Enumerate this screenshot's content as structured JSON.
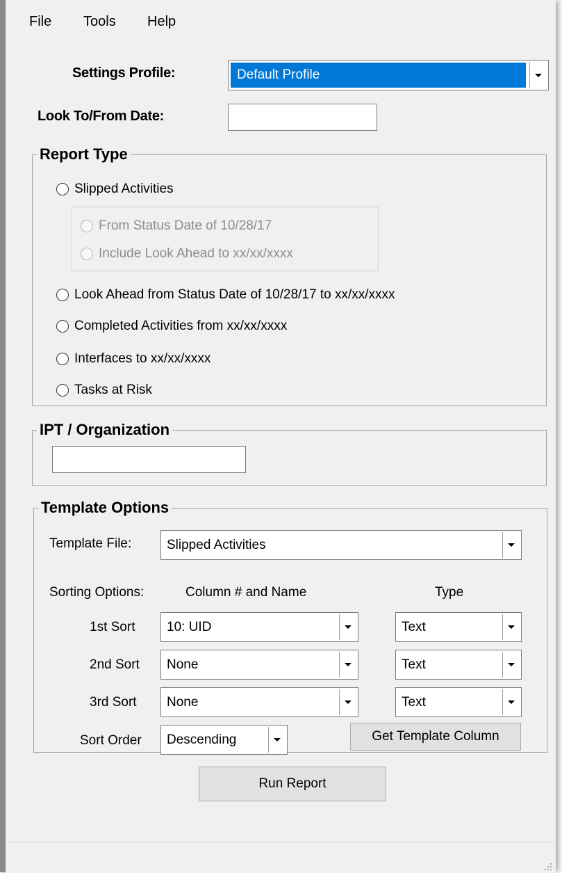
{
  "menu": [
    "File",
    "Tools",
    "Help"
  ],
  "settings_profile": {
    "label": "Settings Profile:",
    "value": "Default Profile"
  },
  "look_date": {
    "label": "Look To/From Date:",
    "value": ""
  },
  "report_type": {
    "title": "Report Type",
    "slipped": "Slipped Activities",
    "sub_options": [
      "From Status Date of 10/28/17",
      "Include Look Ahead to xx/xx/xxxx"
    ],
    "options": [
      "Look Ahead from Status Date of 10/28/17 to xx/xx/xxxx",
      "Completed Activities from xx/xx/xxxx",
      "Interfaces to xx/xx/xxxx",
      "Tasks at Risk"
    ]
  },
  "ipt": {
    "title": "IPT / Organization",
    "value": ""
  },
  "template": {
    "title": "Template Options",
    "file_label": "Template File:",
    "file_value": "Slipped Activities",
    "sorting_label": "Sorting Options:",
    "column_header": "Column # and Name",
    "type_header": "Type",
    "sorts": [
      {
        "label": "1st Sort",
        "column": "10: UID",
        "type": "Text"
      },
      {
        "label": "2nd Sort",
        "column": "None",
        "type": "Text"
      },
      {
        "label": "3rd Sort",
        "column": "None",
        "type": "Text"
      }
    ],
    "order_label": "Sort Order",
    "order_value": "Descending",
    "get_column_button": "Get Template Column"
  },
  "run_button": "Run Report",
  "colors": {
    "selection": "#0078d7",
    "window": "#f0f0f0"
  }
}
